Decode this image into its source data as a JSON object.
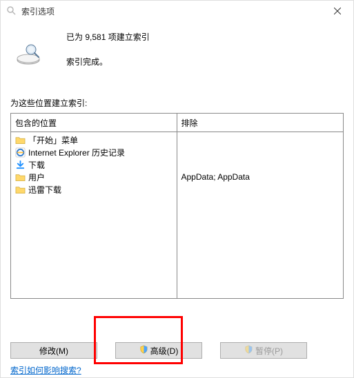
{
  "title": "索引选项",
  "status": {
    "line1": "已为 9,581 项建立索引",
    "line2": "索引完成。"
  },
  "section_label": "为这些位置建立索引:",
  "columns": {
    "included_header": "包含的位置",
    "excluded_header": "排除",
    "included_items": [
      {
        "icon": "folder-icon",
        "label": "「开始」菜单"
      },
      {
        "icon": "ie-icon",
        "label": "Internet Explorer 历史记录"
      },
      {
        "icon": "download-icon",
        "label": "下载"
      },
      {
        "icon": "folder-icon",
        "label": "用户"
      },
      {
        "icon": "folder-icon",
        "label": "迅雷下载"
      }
    ],
    "excluded_items": [
      "",
      "",
      "",
      "AppData; AppData",
      ""
    ]
  },
  "buttons": {
    "modify": "修改(M)",
    "advanced": "高级(D)",
    "pause": "暂停(P)"
  },
  "help_link": "索引如何影响搜索?"
}
